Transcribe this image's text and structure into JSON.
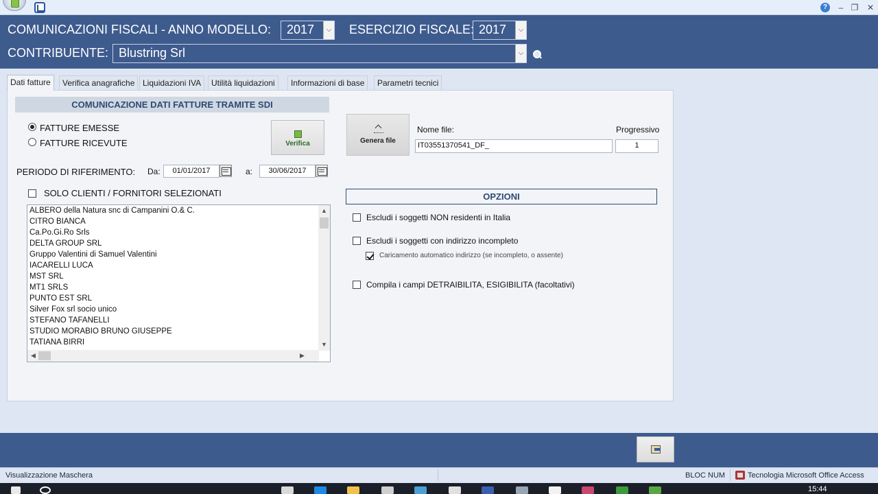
{
  "window": {
    "help_icon": "question-icon",
    "minimize_glyph": "–",
    "restore_glyph": "❐",
    "close_glyph": "✕"
  },
  "header": {
    "title_label": "COMUNICAZIONI FISCALI  - ANNO MODELLO:",
    "anno_modello": "2017",
    "esercizio_label": "ESERCIZIO FISCALE:",
    "esercizio_fiscale": "2017",
    "contribuente_label": "CONTRIBUENTE:",
    "contribuente": "Blustring Srl",
    "dropdown_glyph": "⌵"
  },
  "tabs": [
    {
      "label": "Dati fatture",
      "active": true
    },
    {
      "label": "Verifica anagrafiche"
    },
    {
      "label": "Liquidazioni IVA"
    },
    {
      "label": "Utilità liquidazioni"
    },
    {
      "label": "Informazioni di base"
    },
    {
      "label": "Parametri tecnici"
    }
  ],
  "dati_fatture": {
    "section_title": "COMUNICAZIONE DATI FATTURE TRAMITE SDI",
    "radio_emesse": {
      "label": "FATTURE EMESSE",
      "selected": true
    },
    "radio_ricevute": {
      "label": "FATTURE RICEVUTE",
      "selected": false
    },
    "verifica_label": "Verifica",
    "periodo_label": "PERIODO DI RIFERIMENTO:",
    "da_label": "Da:",
    "da_value": "01/01/2017",
    "a_label": "a:",
    "a_value": "30/06/2017",
    "solo_label": "SOLO CLIENTI / FORNITORI SELEZIONATI",
    "solo_checked": false,
    "clienti": [
      " ALBERO della Natura snc di Campanini O.& C.",
      " CITRO BIANCA",
      "Ca.Po.Gi.Ro Srls",
      "DELTA GROUP SRL",
      "Gruppo Valentini di Samuel Valentini",
      "IACARELLI LUCA",
      "MST SRL",
      "MT1 SRLS",
      "PUNTO EST SRL",
      "Silver Fox srl socio unico",
      "STEFANO TAFANELLI",
      "STUDIO MORABIO BRUNO GIUSEPPE",
      "TATIANA BIRRI"
    ],
    "genera_label": "Genera file",
    "nome_file_label": "Nome file:",
    "nome_file_value": "IT03551370541_DF_",
    "progressivo_label": "Progressivo",
    "progressivo_value": "1"
  },
  "opzioni": {
    "title": "OPZIONI",
    "items": [
      {
        "label": "Escludi i soggetti NON residenti in Italia",
        "checked": false
      },
      {
        "label": "Escludi i soggetti con indirizzo incompleto",
        "checked": false
      },
      {
        "label": "Caricamento automatico indirizzo (se incompleto, o assente)",
        "checked": true
      },
      {
        "label": "Compila i campi DETRAIBILITA, ESIGIBILITA (facoltativi)",
        "checked": false
      }
    ]
  },
  "status": {
    "left": "Visualizzazione Maschera",
    "num": "BLOC NUM",
    "tech": "Tecnologia Microsoft Office Access"
  },
  "taskbar": {
    "time": "15:44"
  },
  "scroll_glyphs": {
    "up": "▲",
    "down": "▼",
    "left": "◀",
    "right": "▶"
  }
}
